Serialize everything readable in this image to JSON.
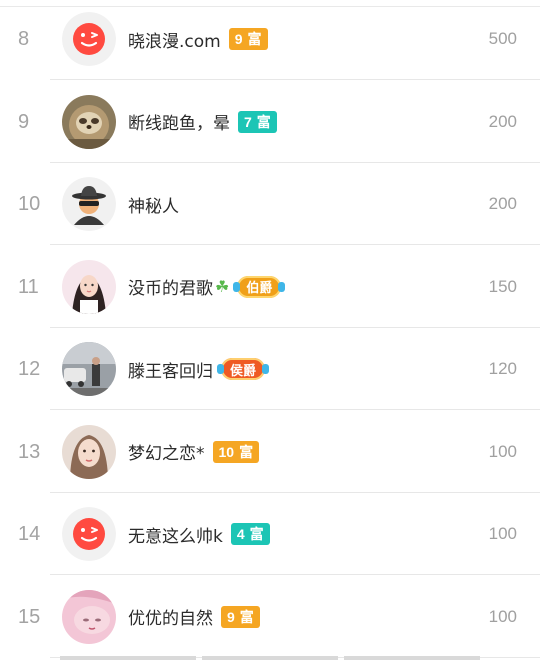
{
  "leaderboard": {
    "rows": [
      {
        "rank": "8",
        "name": "晓浪漫.com",
        "badge_type": "rich",
        "badge_level": "9",
        "badge_text": "富",
        "badge_color": "#f5a623",
        "score": "500",
        "avatar": "default-avatar-icon"
      },
      {
        "rank": "9",
        "name": "断线跑鱼，晕",
        "badge_type": "rich",
        "badge_level": "7",
        "badge_text": "富",
        "badge_color": "#1cc5b5",
        "score": "200",
        "avatar": "sloth-photo-avatar"
      },
      {
        "rank": "10",
        "name": "神秘人",
        "badge_type": "none",
        "score": "200",
        "avatar": "mystery-hat-avatar-icon"
      },
      {
        "rank": "11",
        "name": "没币的君歌",
        "name_suffix_icon": "clover-icon",
        "badge_type": "noble",
        "badge_text": "伯爵",
        "badge_color": "#f0a019",
        "score": "150",
        "avatar": "girl-photo-avatar"
      },
      {
        "rank": "12",
        "name": "滕王客回归",
        "badge_type": "noble",
        "badge_text": "侯爵",
        "badge_color": "#ef5a24",
        "score": "120",
        "avatar": "car-photo-avatar"
      },
      {
        "rank": "13",
        "name": "梦幻之恋*",
        "badge_type": "rich",
        "badge_level": "10",
        "badge_text": "富",
        "badge_color": "#f5a623",
        "score": "100",
        "avatar": "woman-photo-avatar"
      },
      {
        "rank": "14",
        "name": "无意这么帅k",
        "badge_type": "rich",
        "badge_level": "4",
        "badge_text": "富",
        "badge_color": "#1cc5b5",
        "score": "100",
        "avatar": "default-avatar-icon"
      },
      {
        "rank": "15",
        "name": "优优的自然",
        "badge_type": "rich",
        "badge_level": "9",
        "badge_text": "富",
        "badge_color": "#f5a623",
        "score": "100",
        "avatar": "pink-photo-avatar"
      }
    ]
  },
  "colors": {
    "rank_text": "#a3a3a3",
    "score_text": "#a0a0a0",
    "name_text": "#2b2b2b",
    "divider": "#e7e7e7",
    "default_avatar_red": "#ff4a40"
  }
}
